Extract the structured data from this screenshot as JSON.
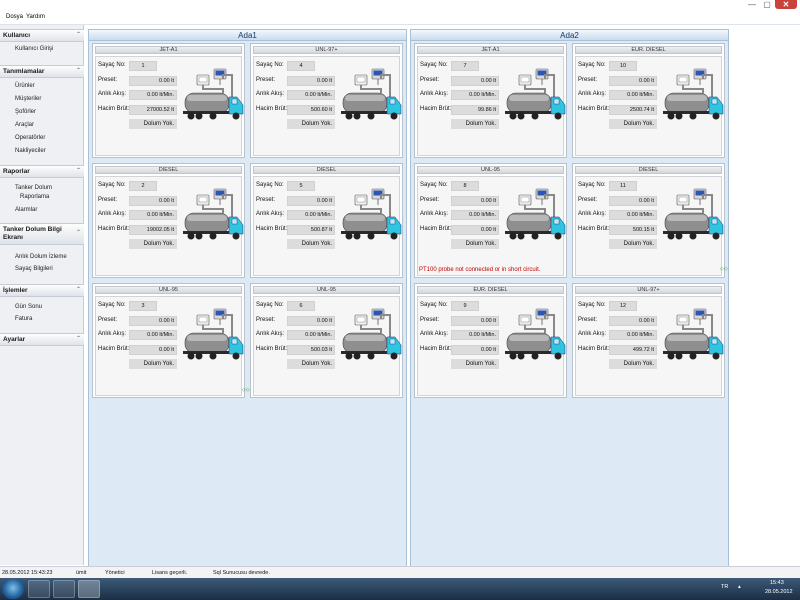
{
  "window": {
    "min_icon": "minimize-icon",
    "max_icon": "maximize-icon",
    "close_icon": "close-icon",
    "close_label": "✕",
    "min_label": "—",
    "max_label": "▢"
  },
  "menu": {
    "items": [
      "Dosya",
      "Yardım"
    ]
  },
  "sidebar": {
    "sections": [
      {
        "title": "Kullanıcı",
        "items": [
          "Kullanıcı Girişi"
        ]
      },
      {
        "title": "Tanımlamalar",
        "items": [
          "Ürünler",
          "Müşteriler",
          "Şoförler",
          "Araçlar",
          "Operatörler",
          "Nakliyeciler"
        ]
      },
      {
        "title": "Raporlar",
        "items": [
          "Tanker Dolum",
          "Raporlama",
          "Alarmlar"
        ]
      },
      {
        "title": "Tanker Dolum Bilgi",
        "title2": "Ekranı",
        "items": [
          "Anlık Dolum İzleme",
          "Sayaç Bilgileri"
        ]
      },
      {
        "title": "İşlemler",
        "items": [
          "Gün Sonu",
          "Fatura"
        ]
      },
      {
        "title": "Ayarlar",
        "items": []
      }
    ],
    "collapse_glyph": "⌃"
  },
  "labels": {
    "sayac": "Sayaç No:",
    "preset": "Preset:",
    "anlik": "Anlık Akış:",
    "hacim": "Hacim Brüt:"
  },
  "islands": [
    {
      "title": "Ada1",
      "cards": [
        {
          "product": "JET-A1",
          "no": "1",
          "preset": "0.00 lt",
          "flow": "0.00 lt/Min.",
          "volume": "27000.52 lt",
          "status": "Dolum Yok."
        },
        {
          "product": "UNL-97+",
          "no": "4",
          "preset": "0.00 lt",
          "flow": "0.00 lt/Min.",
          "volume": "500.60 lt",
          "status": "Dolum Yok."
        },
        {
          "product": "DIESEL",
          "no": "2",
          "preset": "0.00 lt",
          "flow": "0.00 lt/Min.",
          "volume": "19002.05 lt",
          "status": "Dolum Yok."
        },
        {
          "product": "DIESEL",
          "no": "5",
          "preset": "0.00 lt",
          "flow": "0.00 lt/Min.",
          "volume": "500.87 lt",
          "status": "Dolum Yok."
        },
        {
          "product": "UNL-95",
          "no": "3",
          "preset": "0.00 lt",
          "flow": "0.00 lt/Min.",
          "volume": "0.00 lt",
          "status": "Dolum Yok."
        },
        {
          "product": "UNL-95",
          "no": "6",
          "preset": "0.00 lt",
          "flow": "0.00 lt/Min.",
          "volume": "500.03 lt",
          "status": "Dolum Yok."
        }
      ]
    },
    {
      "title": "Ada2",
      "cards": [
        {
          "product": "JET-A1",
          "no": "7",
          "preset": "0.00 lt",
          "flow": "0.00 lt/Min.",
          "volume": "99.86 lt",
          "status": "Dolum Yok."
        },
        {
          "product": "EUR. DIESEL",
          "no": "10",
          "preset": "0.00 lt",
          "flow": "0.00 lt/Min.",
          "volume": "2500.74 lt",
          "status": "Dolum Yok."
        },
        {
          "product": "UNL-95",
          "no": "8",
          "preset": "0.00 lt",
          "flow": "0.00 lt/Min.",
          "volume": "0.00 lt",
          "status": "Dolum Yok.",
          "error": "PT100 probe not connected or in short circuit."
        },
        {
          "product": "DIESEL",
          "no": "11",
          "preset": "0.00 lt",
          "flow": "0.00 lt/Min.",
          "volume": "500.15 lt",
          "status": "Dolum Yok."
        },
        {
          "product": "EUR. DIESEL",
          "no": "9",
          "preset": "0.00 lt",
          "flow": "0.00 lt/Min.",
          "volume": "0.00 lt",
          "status": "Dolum Yok."
        },
        {
          "product": "UNL-97+",
          "no": "12",
          "preset": "0.00 lt",
          "flow": "0.00 lt/Min.",
          "volume": "499.72 lt",
          "status": "Dolum Yok."
        }
      ]
    }
  ],
  "pager_glyph": "◇◇",
  "statusbar": {
    "datetime": "28.05.2012 15:43:23",
    "user": "ümit",
    "role": "Yönetici",
    "license": "Lisans geçerli.",
    "sql": "Sql Sunucusu devrede."
  },
  "taskbar": {
    "lang": "TR",
    "time": "15:43",
    "date": "28.05.2012"
  },
  "colors": {
    "truck_cab": "#2fc4e0",
    "tank": "#8f8f8f",
    "chassis": "#2a2a2a",
    "meter_screen": "#2a56b8",
    "island_bg": "#dde9f5",
    "error": "#c00000"
  }
}
